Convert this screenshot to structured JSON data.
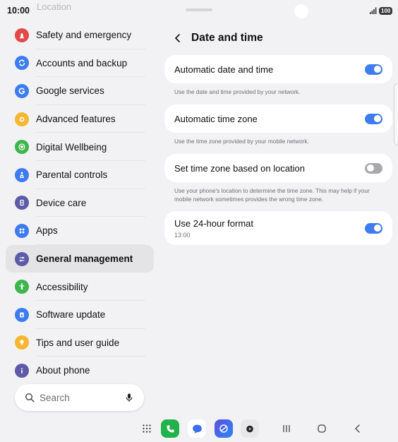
{
  "status_bar": {
    "time": "10:00",
    "ghost_text": "Location",
    "battery": "100"
  },
  "sidebar": {
    "items": [
      {
        "label": "Safety and emergency",
        "icon": "alert-icon",
        "color": "#e24a4a"
      },
      {
        "label": "Accounts and backup",
        "icon": "sync-icon",
        "color": "#3d7cf0"
      },
      {
        "label": "Google services",
        "icon": "google-icon",
        "color": "#3d7cf0"
      },
      {
        "label": "Advanced features",
        "icon": "gear-plus-icon",
        "color": "#f5b731"
      },
      {
        "label": "Digital Wellbeing",
        "icon": "heart-icon",
        "color": "#3cb64a"
      },
      {
        "label": "Parental controls",
        "icon": "family-icon",
        "color": "#3d7cf0"
      },
      {
        "label": "Device care",
        "icon": "device-care-icon",
        "color": "#5d5ba8"
      },
      {
        "label": "Apps",
        "icon": "apps-icon",
        "color": "#3d7cf0"
      },
      {
        "label": "General management",
        "icon": "sliders-icon",
        "color": "#5d5ba8"
      },
      {
        "label": "Accessibility",
        "icon": "accessibility-icon",
        "color": "#3cb64a"
      },
      {
        "label": "Software update",
        "icon": "update-icon",
        "color": "#3d7cf0"
      },
      {
        "label": "Tips and user guide",
        "icon": "bulb-icon",
        "color": "#f5b731"
      },
      {
        "label": "About phone",
        "icon": "info-icon",
        "color": "#5d5ba8"
      }
    ],
    "active_index": 8,
    "search_placeholder": "Search"
  },
  "detail": {
    "title": "Date and time",
    "settings": [
      {
        "label": "Automatic date and time",
        "enabled": true,
        "helper": "Use the date and time provided by your network."
      },
      {
        "label": "Automatic time zone",
        "enabled": true,
        "helper": "Use the time zone provided by your mobile network."
      },
      {
        "label": "Set time zone based on location",
        "enabled": false,
        "helper": "Use your phone's location to determine the time zone. This may help if your mobile network sometimes provides the wrong time zone."
      },
      {
        "label": "Use 24-hour format",
        "sub": "13:00",
        "enabled": true
      }
    ]
  },
  "dock": {
    "apps": [
      "phone-app-icon",
      "messages-app-icon",
      "internet-app-icon",
      "camera-app-icon"
    ],
    "nav": [
      "recents-icon",
      "home-icon",
      "back-icon"
    ]
  },
  "colors": {
    "accent": "#3e7cf0",
    "toggle_off": "#a8a8ad",
    "background": "#f2f2f4"
  }
}
